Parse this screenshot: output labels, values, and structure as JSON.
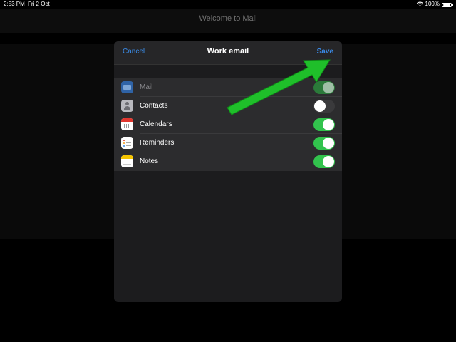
{
  "status_bar": {
    "time": "2:53 PM",
    "date": "Fri 2 Oct",
    "battery": "100%"
  },
  "background": {
    "title": "Welcome to Mail"
  },
  "modal": {
    "title": "Work email",
    "cancel_label": "Cancel",
    "save_label": "Save",
    "items": [
      {
        "label": "Mail",
        "icon": "mail-icon",
        "enabled": true,
        "disabled_row": true
      },
      {
        "label": "Contacts",
        "icon": "contacts-icon",
        "enabled": false,
        "disabled_row": false
      },
      {
        "label": "Calendars",
        "icon": "calendar-icon",
        "enabled": true,
        "disabled_row": false
      },
      {
        "label": "Reminders",
        "icon": "reminders-icon",
        "enabled": true,
        "disabled_row": false
      },
      {
        "label": "Notes",
        "icon": "notes-icon",
        "enabled": true,
        "disabled_row": false
      }
    ]
  },
  "colors": {
    "accent": "#3a8ae6",
    "toggle_on": "#32c34d",
    "annotation_arrow": "#1fbf2a"
  }
}
